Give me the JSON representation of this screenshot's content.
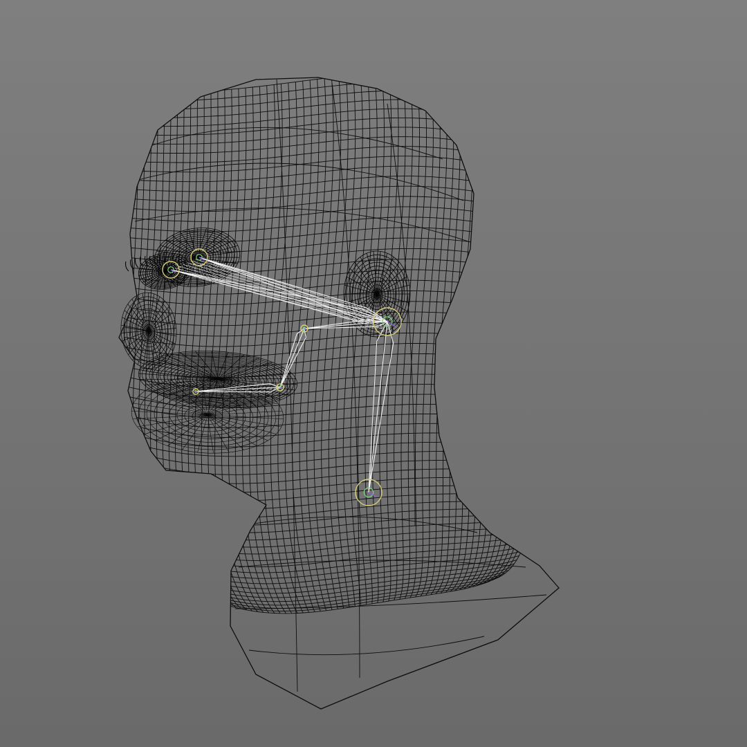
{
  "viewport": {
    "background_top": "#7f7f7f",
    "background_bottom": "#6a6a6a"
  },
  "model": {
    "wire_color": "#0d0d0d",
    "dense_wire_color": "#050505"
  },
  "rig": {
    "bone_color": "#f2f2f2",
    "joint_ring_color": "#d8cf7a",
    "joint_core_color": "#7cd67c",
    "joint_axis_color": "#8f5fd0"
  }
}
